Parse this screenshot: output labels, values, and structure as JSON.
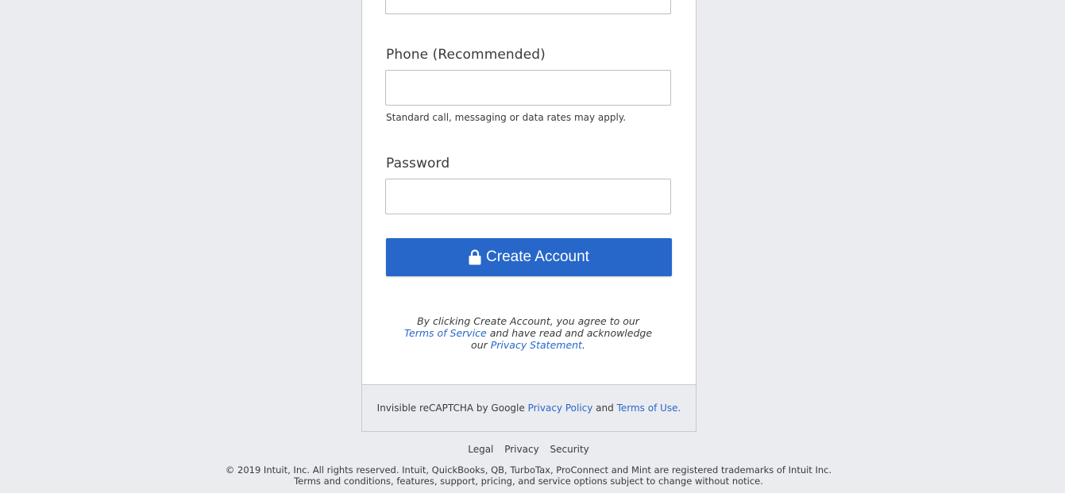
{
  "form": {
    "phone_label": "Phone (Recommended)",
    "phone_value": "",
    "phone_hint": "Standard call, messaging or data rates may apply.",
    "password_label": "Password",
    "password_value": ""
  },
  "create_button": {
    "label": "Create Account",
    "icon": "lock-icon",
    "color": "#2767c9"
  },
  "agreement": {
    "prefix": "By clicking Create Account, you agree to our ",
    "terms_link": "Terms of Service",
    "middle": " and have read and acknowledge our ",
    "privacy_link": "Privacy Statement",
    "suffix": "."
  },
  "recaptcha": {
    "prefix": "Invisible reCAPTCHA by Google ",
    "privacy_link": "Privacy Policy",
    "middle": " and ",
    "terms_link": "Terms of Use."
  },
  "footer": {
    "links": [
      "Legal",
      "Privacy",
      "Security"
    ],
    "copyright_line1": "© 2019 Intuit, Inc. All rights reserved. Intuit, QuickBooks, QB, TurboTax, ProConnect and Mint are registered trademarks of Intuit Inc.",
    "copyright_line2": "Terms and conditions, features, support, pricing, and service options subject to change without notice."
  },
  "colors": {
    "background": "#ebecef",
    "link": "#2767c9"
  }
}
